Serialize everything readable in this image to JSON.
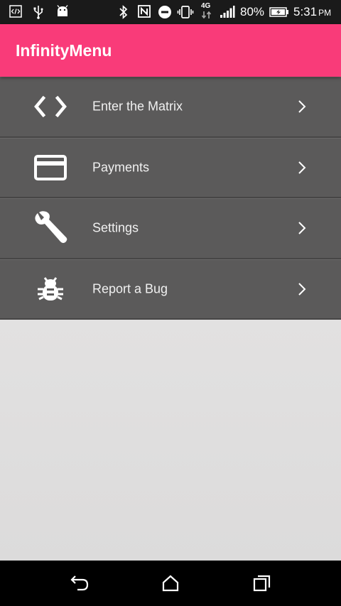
{
  "status_bar": {
    "battery_percent": "80%",
    "time": "5:31",
    "ampm": "PM",
    "network": "4G",
    "icons": [
      "code-icon",
      "usb-icon",
      "android-icon",
      "bluetooth-icon",
      "nfc-icon",
      "do-not-disturb-icon",
      "vibrate-icon",
      "network-4g-icon",
      "signal-icon",
      "battery-charging-icon"
    ]
  },
  "app_bar": {
    "title": "InfinityMenu",
    "color": "#f93b79"
  },
  "menu": {
    "items": [
      {
        "label": "Enter the Matrix",
        "icon": "code-brackets-icon"
      },
      {
        "label": "Payments",
        "icon": "credit-card-icon"
      },
      {
        "label": "Settings",
        "icon": "wrench-icon"
      },
      {
        "label": "Report a Bug",
        "icon": "bug-icon"
      }
    ],
    "item_color": "#5b5a5a"
  },
  "nav_bar": {
    "buttons": [
      "back-icon",
      "home-icon",
      "recents-icon"
    ]
  }
}
